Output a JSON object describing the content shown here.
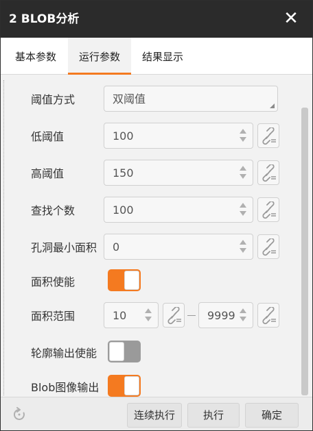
{
  "window": {
    "title": "2 BLOB分析",
    "close_glyph": "✕"
  },
  "tabs": [
    {
      "label": "基本参数",
      "active": false
    },
    {
      "label": "运行参数",
      "active": true
    },
    {
      "label": "结果显示",
      "active": false
    }
  ],
  "params": {
    "threshold_mode": {
      "label": "阈值方式",
      "value": "双阈值"
    },
    "low_threshold": {
      "label": "低阈值",
      "value": "100"
    },
    "high_threshold": {
      "label": "高阈值",
      "value": "150"
    },
    "find_count": {
      "label": "查找个数",
      "value": "100"
    },
    "hole_min_area": {
      "label": "孔洞最小面积",
      "value": "0"
    },
    "area_enable": {
      "label": "面积使能",
      "on": true
    },
    "area_range": {
      "label": "面积范围",
      "min": "10",
      "max": "9999"
    },
    "contour_output_enable": {
      "label": "轮廓输出使能",
      "on": false
    },
    "blob_image_output": {
      "label": "Blob图像输出",
      "on": true
    }
  },
  "footer": {
    "continuous_run_label": "连续执行",
    "run_label": "执行",
    "confirm_label": "确定"
  },
  "icons": {
    "link": "chain-link-icon",
    "refresh": "refresh-icon",
    "close": "close-icon"
  },
  "colors": {
    "accent": "#f47a20",
    "titlebar": "#2b2b2b",
    "toggle_off": "#9a9a9a"
  }
}
